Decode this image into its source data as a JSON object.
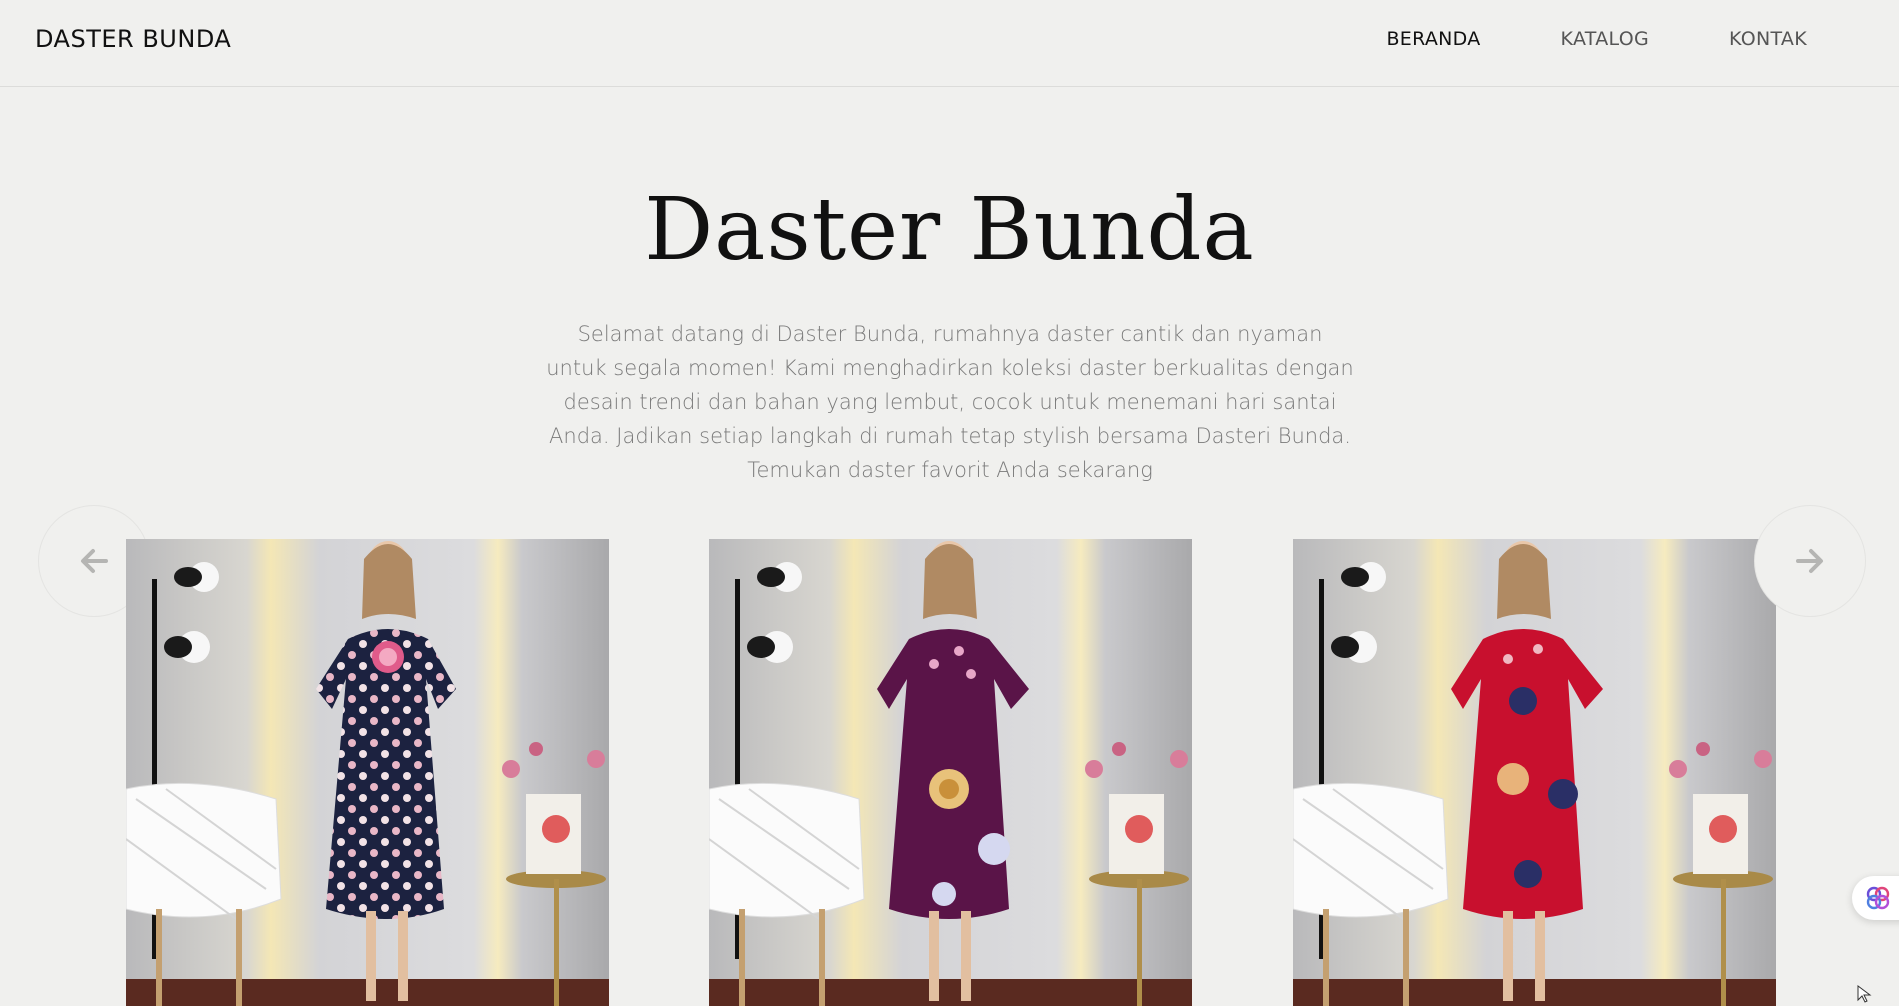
{
  "header": {
    "brand": "DASTER BUNDA",
    "nav": [
      {
        "label": "BERANDA",
        "active": true
      },
      {
        "label": "KATALOG",
        "active": false
      },
      {
        "label": "KONTAK",
        "active": false
      }
    ]
  },
  "hero": {
    "title": "Daster Bunda",
    "description": "Selamat datang di Daster Bunda, rumahnya daster cantik dan nyaman untuk segala momen! Kami menghadirkan koleksi daster berkualitas dengan desain trendi dan bahan yang lembut, cocok untuk menemani hari santai Anda. Jadikan setiap langkah di rumah tetap stylish bersama Dasteri Bunda. Temukan daster favorit Anda sekarang"
  },
  "carousel": {
    "prev_icon": "arrow-left-icon",
    "next_icon": "arrow-right-icon",
    "products": [
      {
        "dress_color": "#1c2240",
        "pattern_color": "#e9b7c7",
        "accent": "navy"
      },
      {
        "dress_color": "#5a1448",
        "pattern_color": "#e8c27a",
        "accent": "plum"
      },
      {
        "dress_color": "#c8102e",
        "pattern_color": "#2a2f66",
        "accent": "red"
      }
    ]
  },
  "colors": {
    "background": "#f0f0ee",
    "text": "#111111",
    "muted": "#7a7a7a"
  }
}
